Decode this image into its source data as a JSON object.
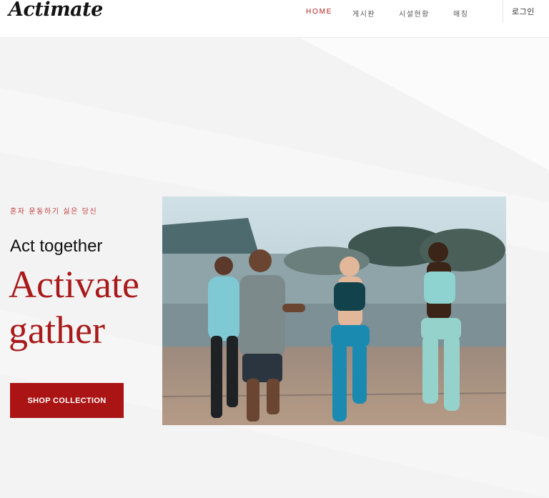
{
  "header": {
    "logo": "Actimate",
    "nav": [
      {
        "label": "HOME",
        "active": true
      },
      {
        "label": "게시판",
        "active": false
      },
      {
        "label": "시설현황",
        "active": false
      },
      {
        "label": "매칭",
        "active": false
      }
    ],
    "login_label": "로그인"
  },
  "hero": {
    "tagline": "혼자 운동하기 싫은 당신",
    "headline_small": "Act together",
    "headline_line1": "Activate",
    "headline_line2": "gather",
    "cta_label": "SHOP COLLECTION"
  },
  "colors": {
    "accent": "#aa1414",
    "nav_active": "#b31d1d",
    "background": "#f4f4f4"
  }
}
